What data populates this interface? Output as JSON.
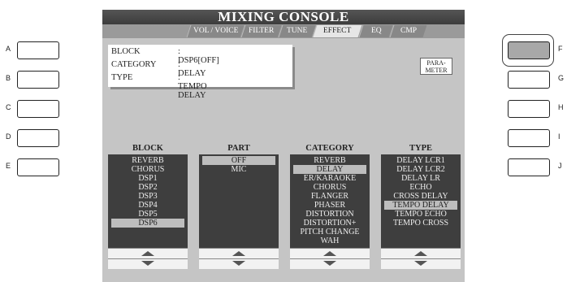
{
  "screen": {
    "title": "MIXING CONSOLE",
    "tabs": [
      {
        "label": "VOL / VOICE",
        "active": false
      },
      {
        "label": "FILTER",
        "active": false
      },
      {
        "label": "TUNE",
        "active": false
      },
      {
        "label": "EFFECT",
        "active": true
      },
      {
        "label": "EQ",
        "active": false
      },
      {
        "label": "CMP",
        "active": false
      }
    ]
  },
  "info": {
    "block_label": "BLOCK",
    "block_value": ": DSP6[OFF]",
    "category_label": "CATEGORY",
    "category_value": ": DELAY",
    "type_label": "TYPE",
    "type_value": ": TEMPO DELAY"
  },
  "parameter_button": {
    "line1": "PARA-",
    "line2": "METER"
  },
  "columns": [
    {
      "title": "BLOCK",
      "items": [
        "REVERB",
        "CHORUS",
        "DSP1",
        "DSP2",
        "DSP3",
        "DSP4",
        "DSP5",
        "DSP6"
      ],
      "selected": "DSP6"
    },
    {
      "title": "PART",
      "items": [
        "OFF",
        "MIC"
      ],
      "selected": "OFF"
    },
    {
      "title": "CATEGORY",
      "items": [
        "REVERB",
        "DELAY",
        "ER/KARAOKE",
        "CHORUS",
        "FLANGER",
        "PHASER",
        "DISTORTION",
        "DISTORTION+",
        "PITCH CHANGE",
        "WAH"
      ],
      "selected": "DELAY"
    },
    {
      "title": "TYPE",
      "items": [
        "DELAY LCR1",
        "DELAY LCR2",
        "DELAY LR",
        "ECHO",
        "CROSS DELAY",
        "TEMPO DELAY",
        "TEMPO ECHO",
        "TEMPO CROSS"
      ],
      "selected": "TEMPO DELAY"
    }
  ],
  "left_buttons": [
    "A",
    "B",
    "C",
    "D",
    "E"
  ],
  "right_buttons": [
    "F",
    "G",
    "H",
    "I",
    "J"
  ],
  "active_button": "F"
}
